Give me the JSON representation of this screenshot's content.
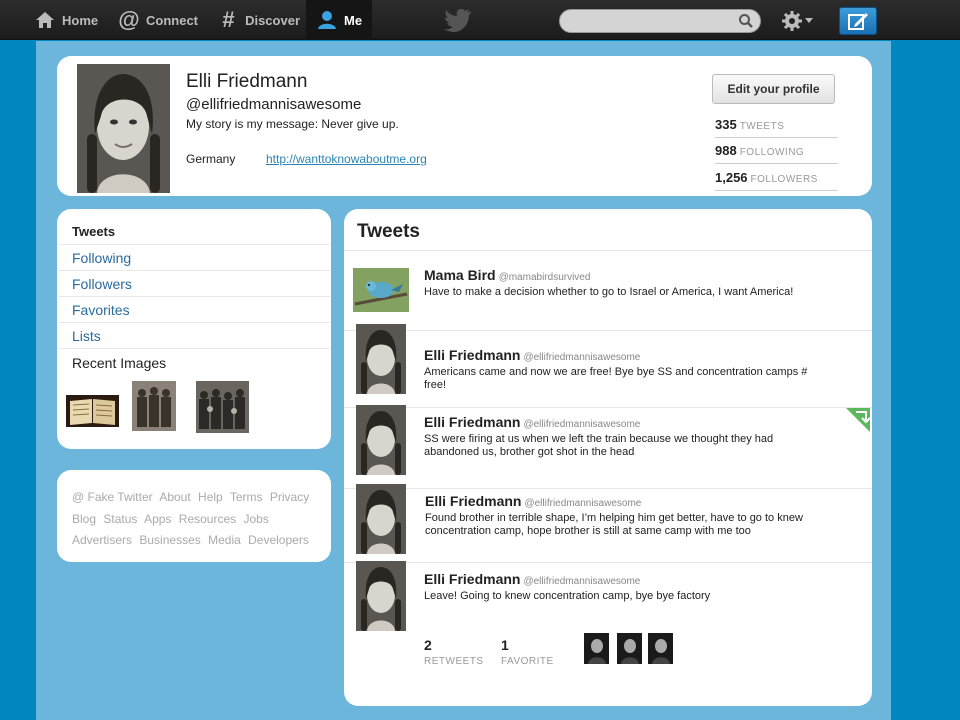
{
  "nav": {
    "home": "Home",
    "connect": "Connect",
    "discover": "Discover",
    "me": "Me",
    "search_placeholder": ""
  },
  "profile": {
    "name": "Elli Friedmann",
    "handle": "@ellifriedmannisawesome",
    "bio": "My story is my message: Never give up.",
    "location": "Germany",
    "url": "http://wanttoknowaboutme.org",
    "edit_label": "Edit your profile",
    "stats": [
      {
        "num": "335",
        "label": "TWEETS"
      },
      {
        "num": "988",
        "label": "FOLLOWING"
      },
      {
        "num": "1,256",
        "label": "FOLLOWERS"
      }
    ]
  },
  "sidebar": {
    "items": [
      "Tweets",
      "Following",
      "Followers",
      "Favorites",
      "Lists"
    ],
    "recent_label": "Recent Images"
  },
  "footer": {
    "links": [
      "@ Fake Twitter",
      "About",
      "Help",
      "Terms",
      "Privacy",
      "Blog",
      "Status",
      "Apps",
      "Resources",
      "Jobs",
      "Advertisers",
      "Businesses",
      "Media",
      "Developers"
    ]
  },
  "timeline": {
    "title": "Tweets",
    "tweets": [
      {
        "name": "Mama Bird",
        "handle": "@mamabirdsurvived",
        "text": "Have to make a decision whether to go to Israel or America, I want America!"
      },
      {
        "name": "Elli Friedmann",
        "handle": "@ellifriedmannisawesome",
        "text": "Americans came and now we are free! Bye bye SS and concentration camps # free!"
      },
      {
        "name": "Elli Friedmann",
        "handle": "@ellifriedmannisawesome",
        "text": "SS were firing at us when we left the train because we thought they had abandoned us, brother got shot in the head"
      },
      {
        "name": "Elli Friedmann",
        "handle": "@ellifriedmannisawesome",
        "text": "Found brother in terrible shape, I’m helping him get better, have to  go to knew concentration camp, hope brother is still at same camp with me too"
      },
      {
        "name": "Elli Friedmann",
        "handle": "@ellifriedmannisawesome",
        "text": "Leave! Going to knew concentration camp, bye bye factory"
      }
    ],
    "retweets": {
      "num": "2",
      "label": "RETWEETS"
    },
    "favorites": {
      "num": "1",
      "label": "FAVORITE"
    }
  },
  "colors": {
    "background": "#0087c0",
    "panel": "#6cb6dc",
    "link": "#2a6b9e"
  }
}
